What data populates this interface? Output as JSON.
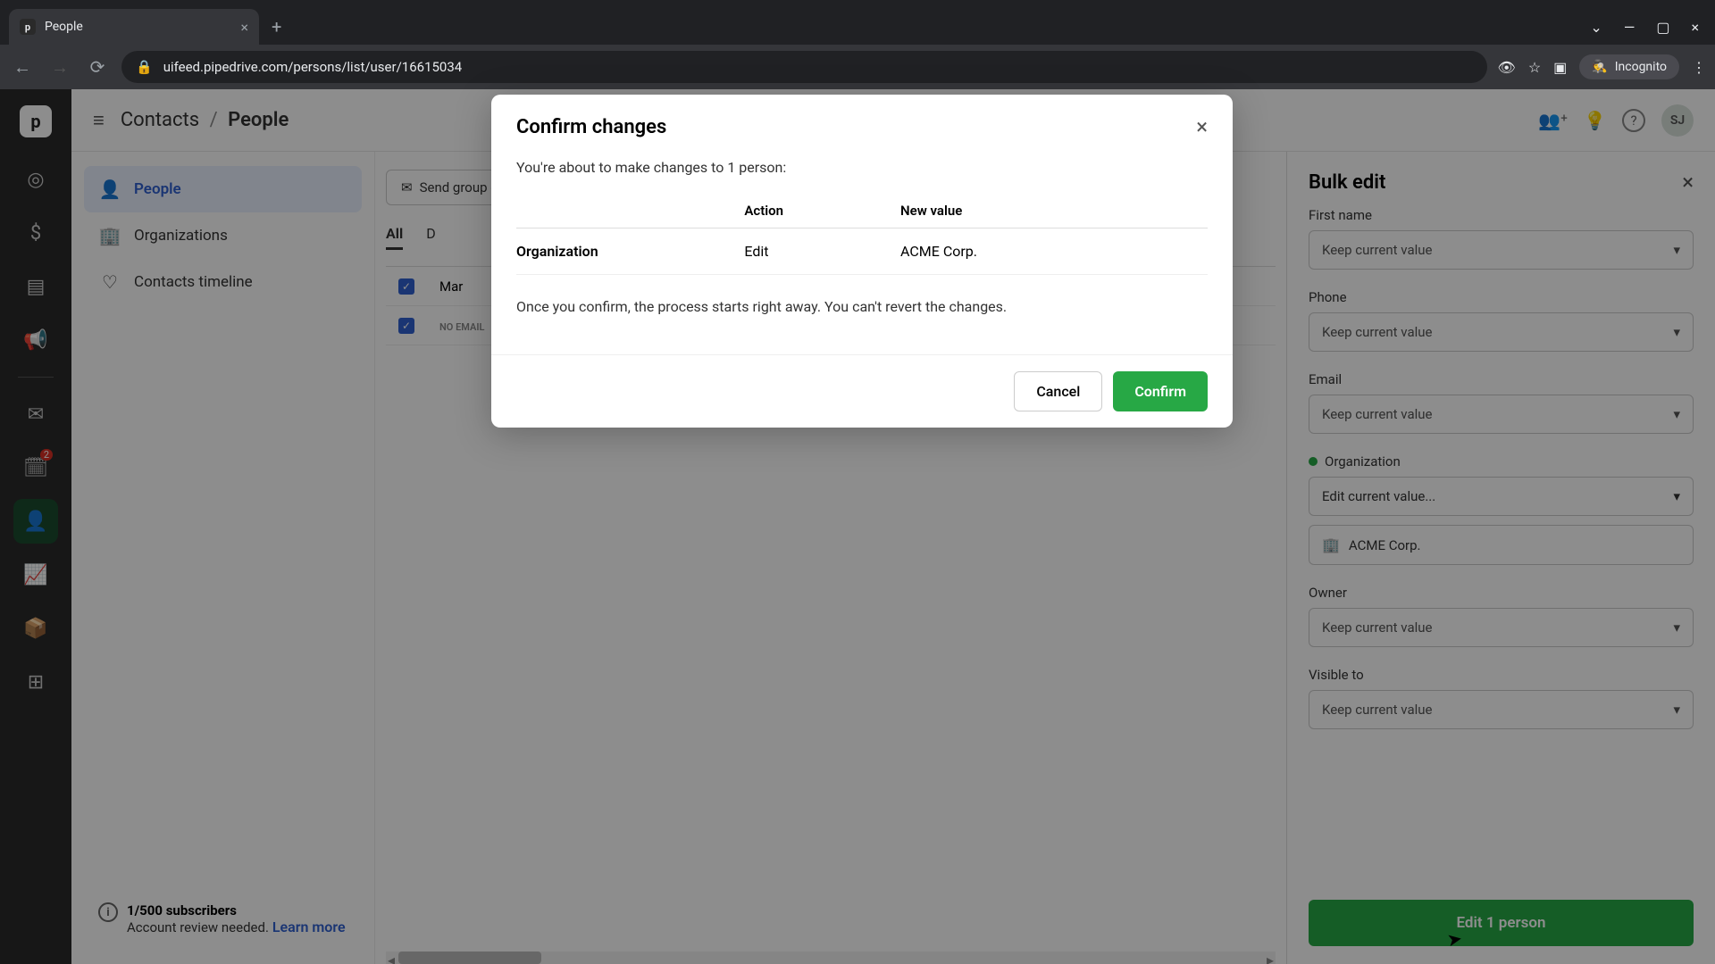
{
  "browser": {
    "tab_title": "People",
    "url_display": "uifeed.pipedrive.com/persons/list/user/16615034",
    "incognito": "Incognito"
  },
  "header": {
    "crumb1": "Contacts",
    "crumb2": "People",
    "avatar": "SJ"
  },
  "left_nav": {
    "items": [
      "People",
      "Organizations",
      "Contacts timeline"
    ],
    "sub_title": "1/500 subscribers",
    "sub_text": "Account review needed.",
    "learn_more": "Learn more"
  },
  "center": {
    "send_email": "Send group email",
    "tabs": {
      "all": "All"
    },
    "row1_name": "Mar",
    "row2_no_email": "NO EMAIL"
  },
  "icon_rail": {
    "badge": "2"
  },
  "right_panel": {
    "title": "Bulk edit",
    "fields": {
      "first_name": {
        "label": "First name",
        "value": "Keep current value"
      },
      "phone": {
        "label": "Phone",
        "value": "Keep current value"
      },
      "email": {
        "label": "Email",
        "value": "Keep current value"
      },
      "organization": {
        "label": "Organization",
        "value": "Edit current value...",
        "org_value": "ACME Corp."
      },
      "owner": {
        "label": "Owner",
        "value": "Keep current value"
      },
      "visible_to": {
        "label": "Visible to",
        "value": "Keep current value"
      }
    },
    "submit": "Edit 1 person"
  },
  "modal": {
    "title": "Confirm changes",
    "intro": "You're about to make changes to 1 person:",
    "cols": {
      "action": "Action",
      "new_value": "New value"
    },
    "row": {
      "field": "Organization",
      "action": "Edit",
      "value": "ACME Corp."
    },
    "warning": "Once you confirm, the process starts right away. You can't revert the changes.",
    "cancel": "Cancel",
    "confirm": "Confirm"
  }
}
